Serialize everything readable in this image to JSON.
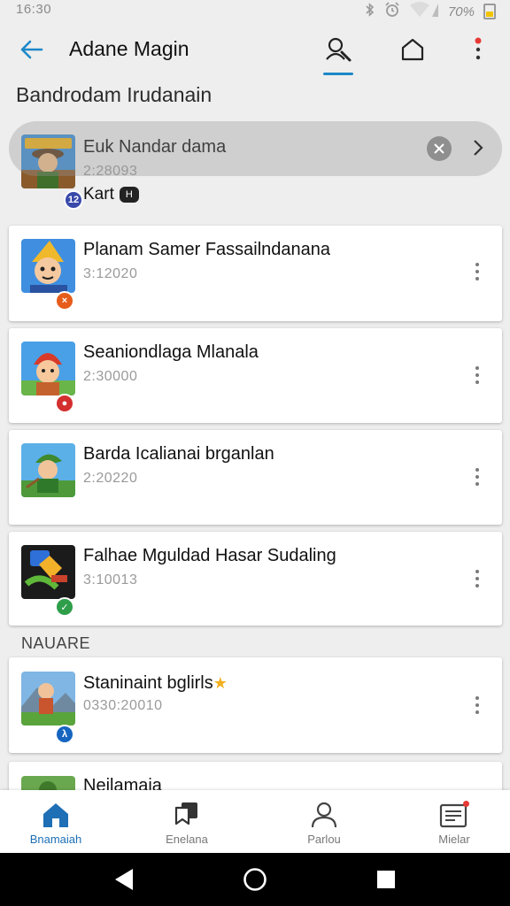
{
  "status_bar": {
    "time": "16:30",
    "battery_text": "70%",
    "icons": [
      "bluetooth-icon",
      "alarm-icon",
      "wifi-icon",
      "battery-icon"
    ]
  },
  "app_bar": {
    "title": "Adane Magin",
    "actions": [
      "search-icon",
      "home-icon",
      "more-vert-icon"
    ],
    "accent": "#1e88c8"
  },
  "section_title": "Bandrodam Irudanain",
  "items": [
    {
      "title": "Euk Nandar dama",
      "subtitle": "2:28093",
      "extra": "Kart",
      "tag": "H",
      "badge": "12",
      "badge_color": "#3949ab"
    },
    {
      "title": "Planam Samer Fassailndanana",
      "subtitle": "3:12020",
      "badge": "×",
      "badge_color": "#e65c1a"
    },
    {
      "title": "Seaniondlaga Mlanala",
      "subtitle": "2:30000",
      "badge": "●",
      "badge_color": "#d32f2f"
    },
    {
      "title": "Barda Icalianai brganlan",
      "subtitle": "2:20220",
      "badge": "",
      "badge_color": ""
    },
    {
      "title": "Falhae Mguldad Hasar Sudaling",
      "subtitle": "3:10013",
      "badge": "✓",
      "badge_color": "#2e9e4a"
    }
  ],
  "section_label": "NAUARE",
  "more_items": [
    {
      "title": "Staninaint bglirls",
      "star": "★",
      "subtitle": "0330:20010",
      "badge": "λ",
      "badge_color": "#1565c0"
    },
    {
      "title": "Neilamaia"
    }
  ],
  "bottom_nav": [
    {
      "label": "Bnamaiah",
      "icon": "home-icon",
      "active": true
    },
    {
      "label": "Enelana",
      "icon": "flag-icon",
      "active": false
    },
    {
      "label": "Parlou",
      "icon": "person-icon",
      "active": false
    },
    {
      "label": "Mielar",
      "icon": "news-icon",
      "active": false,
      "dot": true
    }
  ],
  "colors": {
    "active": "#1e6fb5",
    "background": "#eeeeee",
    "dot": "#e53935"
  }
}
